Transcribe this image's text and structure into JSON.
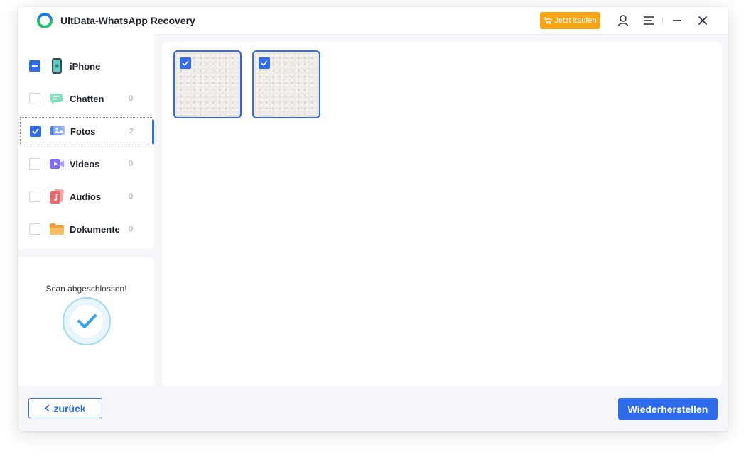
{
  "app": {
    "title": "UltData-WhatsApp Recovery",
    "buy_label": "Jetzt kaufen",
    "accent_color": "#2f6bed",
    "buy_color": "#f7a417"
  },
  "titlebar_icons": [
    "account-icon",
    "menu-icon",
    "minimize-icon",
    "close-icon"
  ],
  "sidebar": {
    "device": {
      "label": "iPhone",
      "icon": "iphone-icon",
      "state": "partial"
    },
    "items": [
      {
        "label": "Chatten",
        "count": "0",
        "icon": "chat-icon",
        "checked": false
      },
      {
        "label": "Fotos",
        "count": "2",
        "icon": "photos-icon",
        "checked": true,
        "active": true
      },
      {
        "label": "Videos",
        "count": "0",
        "icon": "video-icon",
        "checked": false
      },
      {
        "label": "Audios",
        "count": "0",
        "icon": "audio-icon",
        "checked": false
      },
      {
        "label": "Dokumente",
        "count": "0",
        "icon": "folder-icon",
        "checked": false
      }
    ]
  },
  "scan": {
    "status_text": "Scan abgeschlossen!",
    "icon": "checkmark-icon"
  },
  "content": {
    "thumbnails": [
      {
        "checked": true
      },
      {
        "checked": true
      }
    ]
  },
  "footer": {
    "back_label": "zurück",
    "restore_label": "Wiederherstellen"
  }
}
